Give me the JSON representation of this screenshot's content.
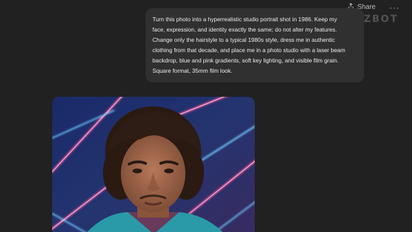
{
  "header": {
    "share_label": "Share",
    "more_label": "···"
  },
  "watermark": {
    "text": "GIZBOT"
  },
  "chat": {
    "user_message": "Turn this photo into a hyperrealistic studio portrait shot in 1986. Keep my\nface, expression, and identity exactly the same; do not alter my features.\nChange only the hairstyle to a typical 1980s style, dress me in authentic\nclothing from that decade, and place me in a photo studio with a laser beam\nbackdrop, blue and pink gradients, soft key lighting, and visible film grain.\nSquare format, 35mm film look."
  },
  "colors": {
    "background": "#212121",
    "bubble": "#303030",
    "text": "#ececec",
    "laser_pink": "#ff5aa0",
    "laser_blue": "#6ec8ff"
  }
}
